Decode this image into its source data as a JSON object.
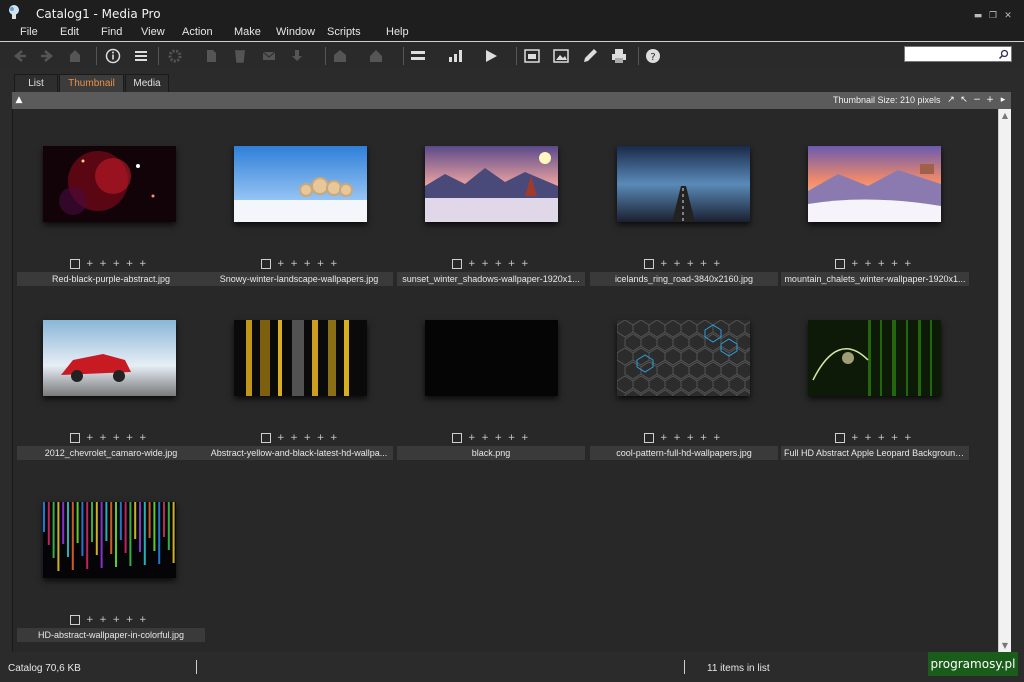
{
  "window": {
    "title": "Catalog1 - Media Pro"
  },
  "menu": [
    "File",
    "Edit",
    "Find",
    "View",
    "Action",
    "Make",
    "Window",
    "Scripts",
    "Help"
  ],
  "search": {
    "value": "",
    "placeholder": ""
  },
  "tabs": [
    {
      "label": "List",
      "active": false
    },
    {
      "label": "Thumbnail",
      "active": true
    },
    {
      "label": "Media",
      "active": false
    }
  ],
  "panel": {
    "thumbnail_size_label": "Thumbnail Size: 210 pixels"
  },
  "items": [
    {
      "filename": "Red-black-purple-abstract.jpg",
      "theme": "red-abstract"
    },
    {
      "filename": "Snowy-winter-landscape-wallpapers.jpg",
      "theme": "snowy-landscape"
    },
    {
      "filename": "sunset_winter_shadows-wallpaper-1920x1...",
      "theme": "winter-sunset"
    },
    {
      "filename": "icelands_ring_road-3840x2160.jpg",
      "theme": "road"
    },
    {
      "filename": "mountain_chalets_winter-wallpaper-1920x1...",
      "theme": "mountain-chalets"
    },
    {
      "filename": "2012_chevrolet_camaro-wide.jpg",
      "theme": "camaro"
    },
    {
      "filename": "Abstract-yellow-and-black-latest-hd-wallpa...",
      "theme": "yellow-stripes"
    },
    {
      "filename": "black.png",
      "theme": "black"
    },
    {
      "filename": "cool-pattern-full-hd-wallpapers.jpg",
      "theme": "hex-pattern"
    },
    {
      "filename": "Full HD Abstract Apple Leopard Background...",
      "theme": "green-abstract"
    },
    {
      "filename": "HD-abstract-wallpaper-in-colorful.jpg",
      "theme": "colorful-stripes"
    }
  ],
  "status": {
    "catalog": "Catalog  70,6 KB",
    "count": "11 items in list"
  },
  "watermark": "programosy.pl",
  "colors": {
    "active_tab": "#e7904a",
    "background": "#282828",
    "panel_header": "#5b5b5b"
  }
}
